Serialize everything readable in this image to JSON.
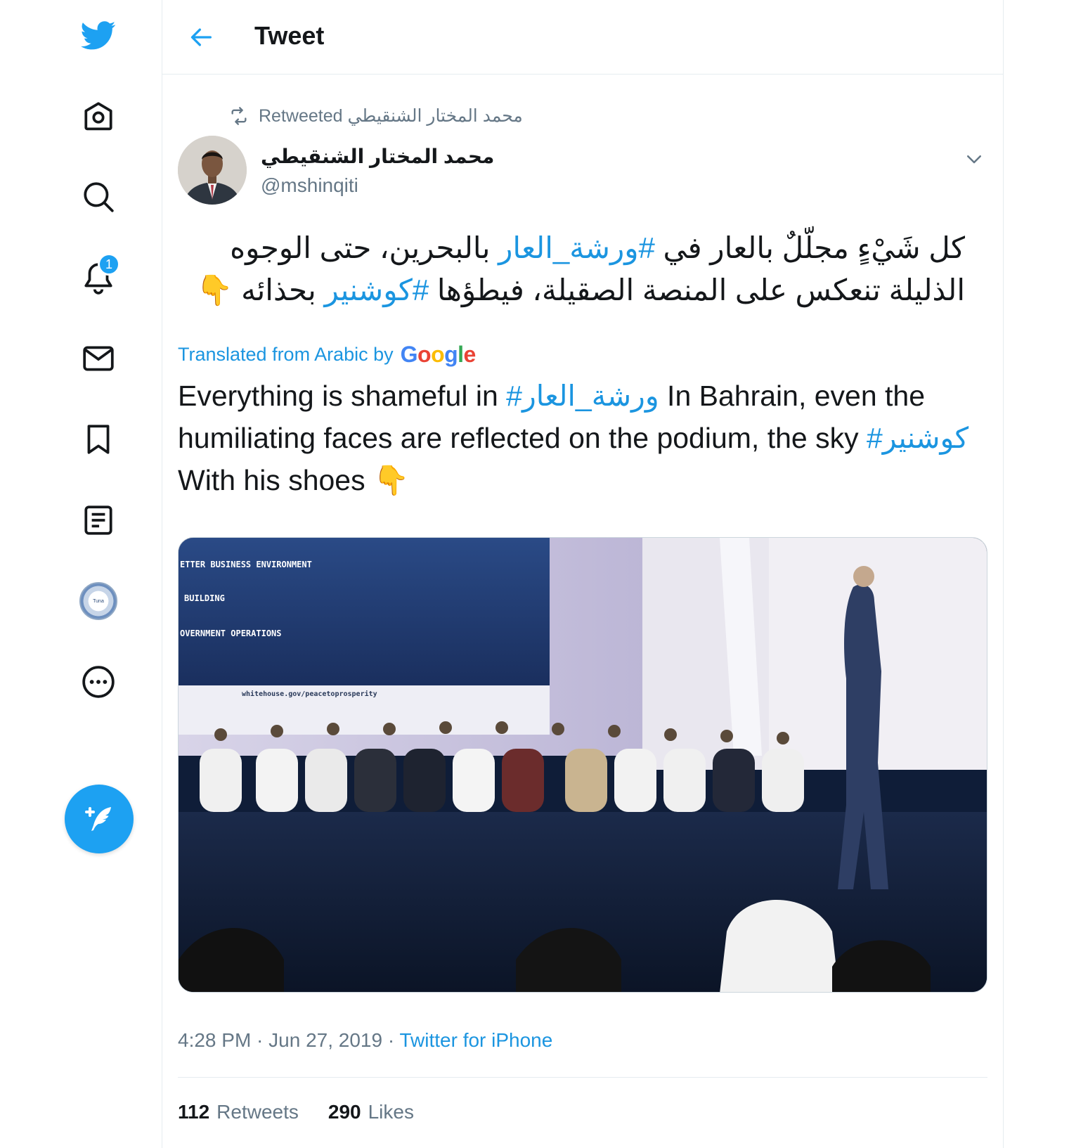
{
  "header": {
    "title": "Tweet"
  },
  "nav": {
    "items": [
      "twitter-logo",
      "home-icon",
      "search-icon",
      "notifications-icon",
      "messages-icon",
      "bookmarks-icon",
      "lists-icon",
      "profile",
      "more-icon",
      "compose-icon"
    ],
    "notification_count": "1",
    "profile_badge_text": "Tuna"
  },
  "tweet": {
    "retweeted_by": "محمد المختار الشنقيطي Retweeted",
    "display_name": "محمد المختار الشنقيطي",
    "handle": "@mshinqiti",
    "arabic": {
      "part1": "كل شَيْءٍ مجلّلٌ بالعار في ",
      "hashtag1": "#ورشة_العار",
      "part2": " بالبحرين، حتى الوجوه الذليلة تنعكس على المنصة الصقيلة، فيطؤها ",
      "hashtag2": "#كوشنير",
      "part3": " بحذائه ",
      "emoji": "👇"
    },
    "translated_label": "Translated from Arabic by",
    "google": [
      "G",
      "o",
      "o",
      "g",
      "l",
      "e"
    ],
    "english": {
      "part1": "Everything is shameful in ",
      "hashtag1": "ورشة_العار#",
      "part2": " In Bahrain, even the humiliating faces are reflected on the podium, the sky ",
      "hashtag2": "كوشنير#",
      "part3": " With his shoes ",
      "emoji": "👇"
    },
    "image_text": {
      "line1": "ETTER BUSINESS ENVIRONMENT",
      "line2": "BUILDING",
      "line3": "OVERNMENT OPERATIONS",
      "url": "whitehouse.gov/peacetoprosperity"
    },
    "time": "4:28 PM · Jun 27, 2019 · ",
    "source": "Twitter for iPhone",
    "retweets_count": "112",
    "retweets_label": "Retweets",
    "likes_count": "290",
    "likes_label": "Likes"
  },
  "colors": {
    "accent": "#1da1f2",
    "link": "#1b95e0",
    "muted": "#657786",
    "text": "#14171a"
  }
}
